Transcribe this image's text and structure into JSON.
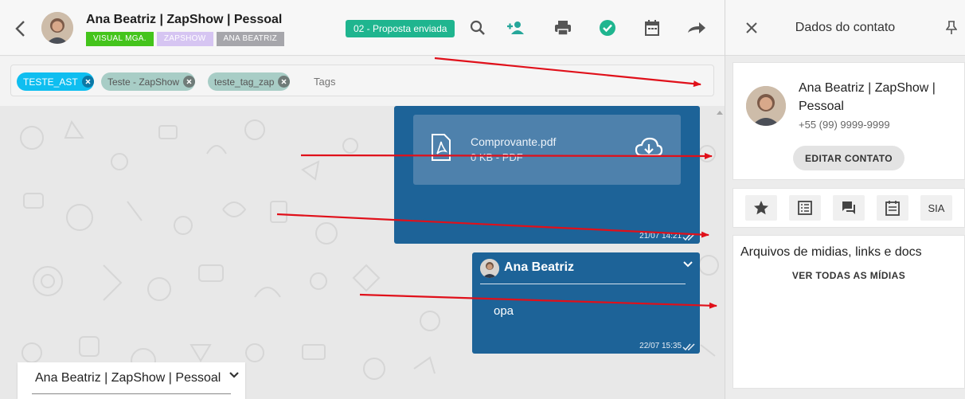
{
  "header": {
    "contact_name": "Ana Beatriz | ZapShow | Pessoal",
    "tags": [
      {
        "label": "VISUAL MGA.",
        "color": "#44c41c"
      },
      {
        "label": "ZAPSHOW",
        "color": "#d6c5f2"
      },
      {
        "label": "ANA BEATRIZ",
        "color": "#a6a6ab"
      }
    ],
    "stage_badge": "02 - Proposta enviada",
    "icons": [
      "back-arrow-icon",
      "search-icon",
      "add-group-icon",
      "print-icon",
      "check-circle-icon",
      "calendar-icon",
      "forward-icon"
    ]
  },
  "tags_bar": {
    "chips": [
      {
        "label": "TESTE_AST",
        "style": "blue"
      },
      {
        "label": "Teste - ZapShow",
        "style": "teal"
      },
      {
        "label": "teste_tag_zap",
        "style": "teal"
      }
    ],
    "placeholder": "Tags"
  },
  "messages": [
    {
      "type": "file",
      "file_name": "Comprovante.pdf",
      "file_meta": "0 KB - PDF",
      "time": "21/07 14:21"
    },
    {
      "type": "text",
      "sender": "Ana Beatriz",
      "text": "opa",
      "time": "22/07 15:35"
    }
  ],
  "quoted_preview": {
    "name": "Ana Beatriz  | ZapShow | Pessoal"
  },
  "right_panel": {
    "title": "Dados do contato",
    "contact": {
      "name": "Ana Beatriz | ZapShow | Pessoal",
      "phone": "+55 (99) 9999-9999",
      "edit_label": "EDITAR CONTATO"
    },
    "tool_buttons": [
      "star-icon",
      "list-icon",
      "chat-icon",
      "calendar-icon",
      "SIA"
    ],
    "sia_label": "SIA",
    "media": {
      "title": "Arquivos de midias, links e docs",
      "link_label": "VER TODAS AS MÍDIAS"
    }
  },
  "colors": {
    "bubble": "#1d6398",
    "file_box": "#4e81ac",
    "stage_badge": "#1fb58f",
    "chip_blue": "#0fbef0",
    "chip_teal": "#a8cdc6",
    "annotation_arrow": "#e0101a"
  }
}
